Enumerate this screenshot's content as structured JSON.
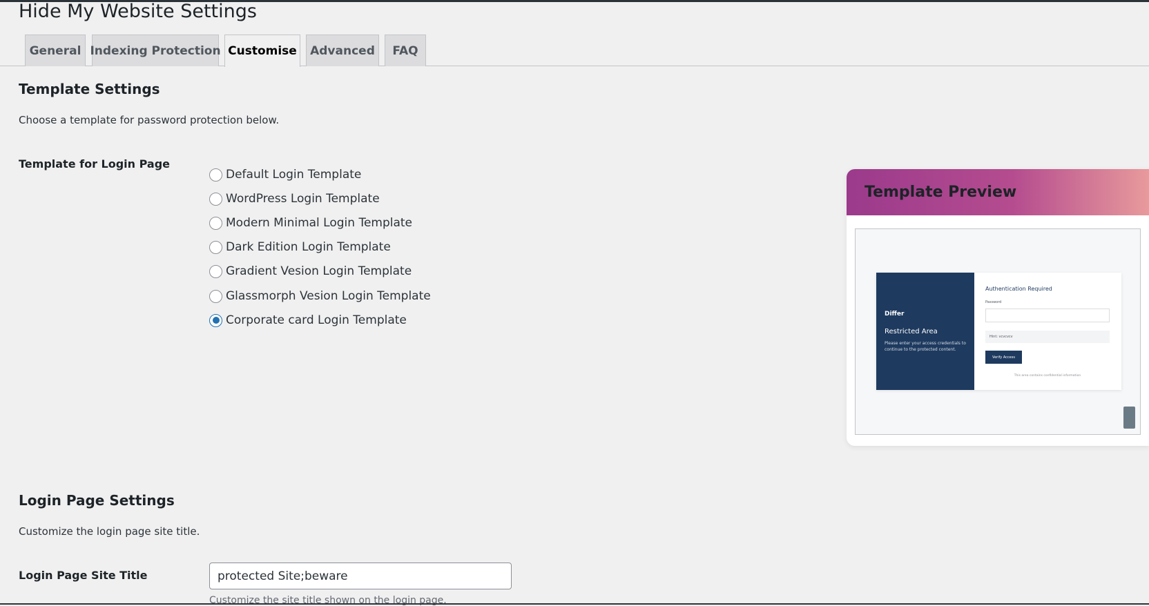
{
  "page_title": "Hide My Website Settings",
  "tabs": [
    {
      "label": "General"
    },
    {
      "label": "Indexing Protection"
    },
    {
      "label": "Customise"
    },
    {
      "label": "Advanced"
    },
    {
      "label": "FAQ"
    }
  ],
  "active_tab": "Customise",
  "template_settings": {
    "title": "Template Settings",
    "description": "Choose a template for password protection below.",
    "field_label": "Template for Login Page",
    "options": [
      {
        "label": "Default Login Template",
        "checked": false
      },
      {
        "label": "WordPress Login Template",
        "checked": false
      },
      {
        "label": "Modern Minimal Login Template",
        "checked": false
      },
      {
        "label": "Dark Edition Login Template",
        "checked": false
      },
      {
        "label": "Gradient Vesion Login Template",
        "checked": false
      },
      {
        "label": "Glassmorph Vesion Login Template",
        "checked": false
      },
      {
        "label": "Corporate card Login Template",
        "checked": true
      }
    ]
  },
  "preview": {
    "title": "Template Preview",
    "brand": "Differ",
    "heading": "Restricted Area",
    "text": "Please enter your access credentials to continue to the protected content.",
    "auth_title": "Authentication Required",
    "password_label": "Password",
    "hint": "Hint: vcvcvcv",
    "button": "Verify Access",
    "footer": "This area contains confidential information"
  },
  "login_settings": {
    "title": "Login Page Settings",
    "description": "Customize the login page site title.",
    "field_label": "Login Page Site Title",
    "site_title_value": "protected Site;beware",
    "help": "Customize the site title shown on the login page."
  }
}
